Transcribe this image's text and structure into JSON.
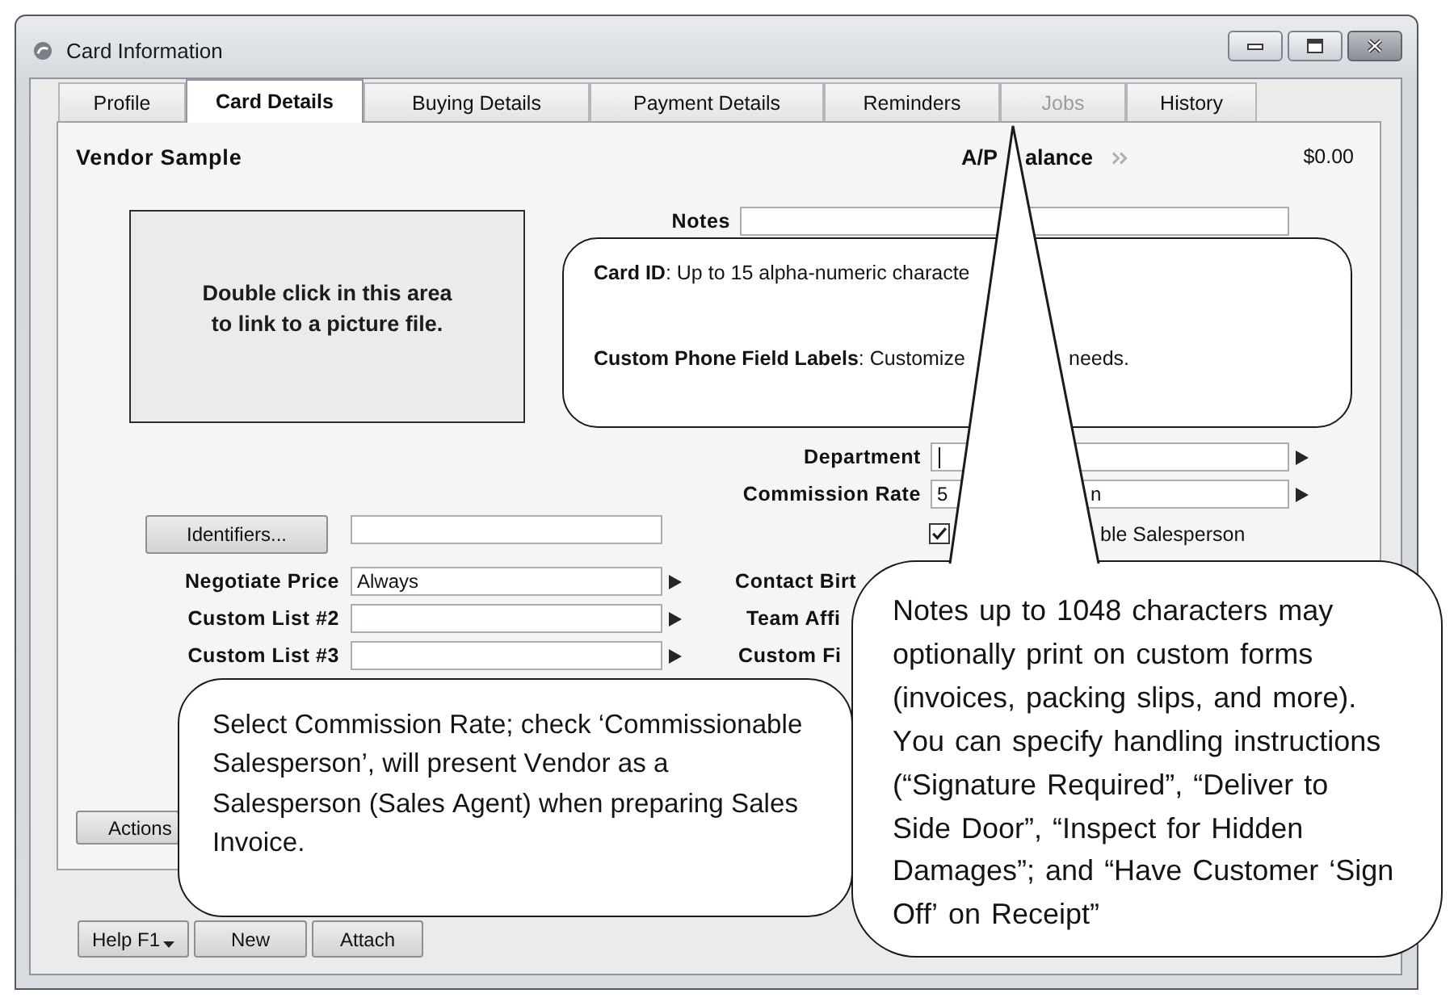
{
  "window": {
    "title": "Card Information"
  },
  "tabs": [
    {
      "label": "Profile",
      "selected": false,
      "disabled": false
    },
    {
      "label": "Card Details",
      "selected": true,
      "disabled": false
    },
    {
      "label": "Buying Details",
      "selected": false,
      "disabled": false
    },
    {
      "label": "Payment Details",
      "selected": false,
      "disabled": false
    },
    {
      "label": "Reminders",
      "selected": false,
      "disabled": false
    },
    {
      "label": "Jobs",
      "selected": false,
      "disabled": true
    },
    {
      "label": "History",
      "selected": false,
      "disabled": false
    }
  ],
  "header": {
    "name": "Vendor Sample",
    "balance_label": "A/P",
    "balance_label_after_pointer": "alance",
    "balance": "$0.00"
  },
  "picture_area": {
    "text": "Double click in this area to link to a picture file."
  },
  "fields_right": [
    {
      "kind": "text",
      "label": "Notes"
    },
    {
      "kind": "select",
      "label": "Department",
      "focused": true
    },
    {
      "kind": "select",
      "label": "Commission Rate",
      "value": "5",
      "value_after_pointer": "n"
    },
    {
      "kind": "checkbox",
      "label": "ble Salesperson",
      "checked": true
    },
    {
      "kind": "label",
      "label": "Contact Birt"
    },
    {
      "kind": "label",
      "label": "Team Affi"
    },
    {
      "kind": "label",
      "label": "Custom Fi"
    }
  ],
  "fields_left": [
    {
      "kind": "button-field",
      "label": "Identifiers..."
    },
    {
      "kind": "select",
      "label": "Negotiate Price",
      "value": "Always"
    },
    {
      "kind": "select",
      "label": "Custom List #2"
    },
    {
      "kind": "select",
      "label": "Custom List #3"
    }
  ],
  "actions_button": {
    "label": "Actions"
  },
  "footer_buttons": [
    {
      "kind": "dropdown",
      "label": "Help F1"
    },
    {
      "kind": "plain",
      "label": "New"
    },
    {
      "kind": "plain",
      "label": "Attach"
    }
  ],
  "callouts": [
    {
      "kind": "box",
      "paragraphs": [
        {
          "text": "**Card ID**: Up to 15 alpha-numeric characte"
        },
        {
          "text": "**Custom Phone Field Labels**: Customize",
          "text_after_pointer": "needs."
        }
      ]
    },
    {
      "kind": "pointer",
      "text": "Notes up to 1048 characters may optionally print on custom forms (invoices, packing slips, and more). You can specify handling instructions (“Signature Required”, “Deliver to Side Door”, “Inspect for Hidden Damages”; and “Have Customer ‘Sign Off’ on Receipt”"
    },
    {
      "kind": "box",
      "text": "Select Commission Rate; check ‘Commissionable Salesperson’, will present Vendor as a Salesperson (Sales Agent) when preparing Sales Invoice."
    }
  ]
}
